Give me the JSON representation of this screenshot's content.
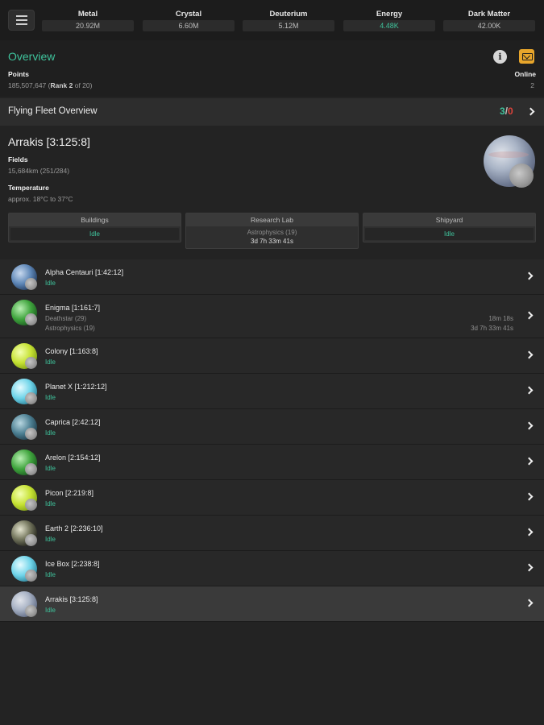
{
  "resources": [
    {
      "name": "Metal",
      "value": "20.92M",
      "color": "#bdbdbd"
    },
    {
      "name": "Crystal",
      "value": "6.60M",
      "color": "#bdbdbd"
    },
    {
      "name": "Deuterium",
      "value": "5.12M",
      "color": "#bdbdbd"
    },
    {
      "name": "Energy",
      "value": "4.48K",
      "color": "#3fc39c"
    },
    {
      "name": "Dark Matter",
      "value": "42.00K",
      "color": "#bdbdbd"
    }
  ],
  "overview": {
    "title": "Overview",
    "points_label": "Points",
    "points_value": "185,507,647",
    "rank_open": " (",
    "rank_label": "Rank 2",
    "rank_suffix": " of 20)",
    "online_label": "Online",
    "online_value": "2",
    "icons": [
      "info-icon",
      "mail-icon"
    ]
  },
  "fleet": {
    "title": "Flying Fleet Overview",
    "own": "3",
    "sep": "/",
    "hostile": "0"
  },
  "planet": {
    "name": "Arrakis [3:125:8]",
    "fields_label": "Fields",
    "fields_value": "15,684km (251/284)",
    "temp_label": "Temperature",
    "temp_value": "approx. 18°C to 37°C",
    "buildings": {
      "label": "Buildings",
      "status": "Idle"
    },
    "research": {
      "label": "Research Lab",
      "item": "Astrophysics (19)",
      "time": "3d 7h 33m 41s"
    },
    "shipyard": {
      "label": "Shipyard",
      "status": "Idle"
    }
  },
  "planets": [
    {
      "name": "Alpha Centauri [1:42:12]",
      "status": "Idle",
      "style": "t-blue"
    },
    {
      "name": "Enigma [1:161:7]",
      "status": "",
      "line1": "Deathstar (29)",
      "line2": "Astrophysics (19)",
      "time1": "18m 18s",
      "time2": "3d 7h 33m 41s",
      "style": "t-green"
    },
    {
      "name": "Colony [1:163:8]",
      "status": "Idle",
      "style": "t-lime"
    },
    {
      "name": "Planet X [1:212:12]",
      "status": "Idle",
      "style": "t-cyan"
    },
    {
      "name": "Caprica [2:42:12]",
      "status": "Idle",
      "style": "t-teal"
    },
    {
      "name": "Arelon [2:154:12]",
      "status": "Idle",
      "style": "t-green"
    },
    {
      "name": "Picon [2:219:8]",
      "status": "Idle",
      "style": "t-lime"
    },
    {
      "name": "Earth 2 [2:236:10]",
      "status": "Idle",
      "style": "t-dark"
    },
    {
      "name": "Ice Box [2:238:8]",
      "status": "Idle",
      "style": "t-cyan"
    },
    {
      "name": "Arrakis [3:125:8]",
      "status": "Idle",
      "style": "t-arrakis",
      "active": true
    }
  ],
  "colors": {
    "accent": "#3fc39c",
    "alert": "#e0433b",
    "mail": "#e7a52b"
  }
}
